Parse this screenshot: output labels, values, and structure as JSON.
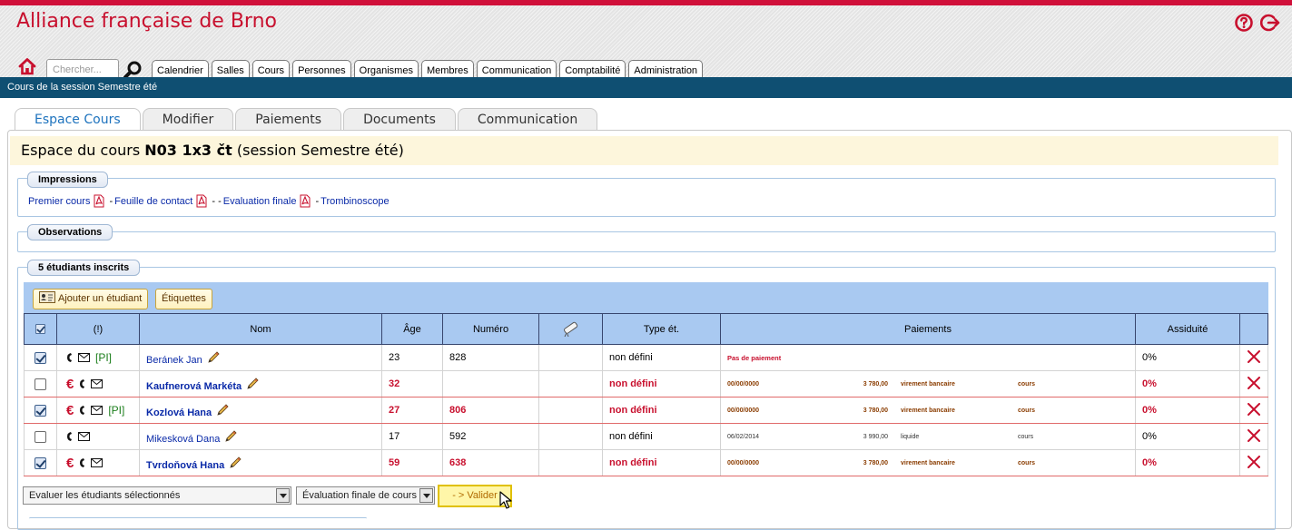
{
  "app": {
    "title": "Alliance française de Brno"
  },
  "search": {
    "placeholder": "Chercher..."
  },
  "nav": {
    "tabs": [
      "Calendrier",
      "Salles",
      "Cours",
      "Personnes",
      "Organismes",
      "Membres",
      "Communication",
      "Comptabilité",
      "Administration"
    ]
  },
  "subbar": {
    "text": "Cours de la session Semestre été"
  },
  "sub_tabs": [
    "Espace Cours",
    "Modifier",
    "Paiements",
    "Documents",
    "Communication"
  ],
  "course": {
    "prefix": "Espace du cours",
    "code": "N03 1x3 čt",
    "suffix": "(session Semestre été)"
  },
  "impressions": {
    "legend": "Impressions",
    "links": [
      "Premier cours",
      "Feuille de contact",
      "Evaluation finale",
      "Trombinoscope"
    ]
  },
  "observations": {
    "legend": "Observations"
  },
  "students": {
    "legend": "5 étudiants inscrits",
    "add_button": "Ajouter un étudiant",
    "labels_button": "Étiquettes",
    "headers": {
      "flags": "(!)",
      "name": "Nom",
      "age": "Âge",
      "number": "Numéro",
      "type": "Type ét.",
      "payments": "Paiements",
      "attendance": "Assiduité"
    },
    "rows": [
      {
        "checked": true,
        "unpaid": false,
        "euro": false,
        "pi": true,
        "name": "Beránek Jan",
        "age": "23",
        "number": "828",
        "type": "non défini",
        "payment": {
          "none": "Pas de paiement"
        },
        "attendance": "0%"
      },
      {
        "checked": false,
        "unpaid": true,
        "euro": true,
        "pi": false,
        "name": "Kaufnerová Markéta",
        "age": "32",
        "number": "",
        "type": "non défini",
        "payment": {
          "date": "00/00/0000",
          "amount": "3 780,00",
          "method": "virement bancaire",
          "kind": "cours"
        },
        "attendance": "0%"
      },
      {
        "checked": true,
        "unpaid": true,
        "euro": true,
        "pi": true,
        "name": "Kozlová Hana",
        "age": "27",
        "number": "806",
        "type": "non défini",
        "payment": {
          "date": "00/00/0000",
          "amount": "3 780,00",
          "method": "virement bancaire",
          "kind": "cours"
        },
        "attendance": "0%"
      },
      {
        "checked": false,
        "unpaid": false,
        "euro": false,
        "pi": false,
        "name": "Mikesková Dana",
        "age": "17",
        "number": "592",
        "type": "non défini",
        "payment": {
          "date": "06/02/2014",
          "amount": "3 990,00",
          "method": "liquide",
          "kind": "cours"
        },
        "attendance": "0%"
      },
      {
        "checked": true,
        "unpaid": true,
        "euro": true,
        "pi": false,
        "name": "Tvrdoňová Hana",
        "age": "59",
        "number": "638",
        "type": "non défini",
        "payment": {
          "date": "00/00/0000",
          "amount": "3 780,00",
          "method": "virement bancaire",
          "kind": "cours"
        },
        "attendance": "0%"
      }
    ],
    "flag_labels": {
      "euro": "€",
      "pi": "[PI]"
    }
  },
  "actions": {
    "evaluate_select": "Evaluer les étudiants sélectionnés",
    "evaluation_type_select": "Évaluation finale de cours",
    "validate_button": "- > Valider"
  },
  "colors": {
    "brand_red": "#c8102e",
    "bar_blue": "#0f4f72",
    "table_header": "#a9c9f1"
  }
}
